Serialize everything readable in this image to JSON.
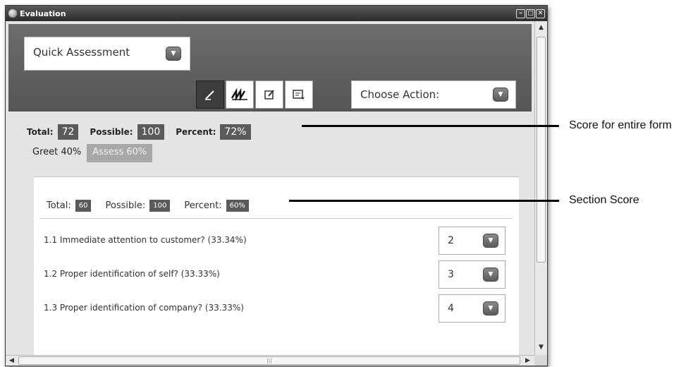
{
  "window": {
    "title": "Evaluation"
  },
  "form_select": {
    "value": "Quick Assessment"
  },
  "toolbar": {
    "tools": [
      "pen-icon",
      "signature-icon",
      "edit-note-icon",
      "preview-icon"
    ],
    "action_select": "Choose Action:"
  },
  "form_score": {
    "total_label": "Total:",
    "total": "72",
    "possible_label": "Possible:",
    "possible": "100",
    "percent_label": "Percent:",
    "percent": "72%"
  },
  "tabs": [
    {
      "label": "Greet 40%",
      "active": true
    },
    {
      "label": "Assess 60%",
      "active": false
    }
  ],
  "section_score": {
    "total_label": "Total:",
    "total": "60",
    "possible_label": "Possible:",
    "possible": "100",
    "percent_label": "Percent:",
    "percent": "60%"
  },
  "questions": [
    {
      "label": "1.1 Immediate attention to customer? (33.34%)",
      "value": "2"
    },
    {
      "label": "1.2 Proper identification of self? (33.33%)",
      "value": "3"
    },
    {
      "label": "1.3 Proper identification of company? (33.33%)",
      "value": "4"
    }
  ],
  "annotations": {
    "form_score": "Score for entire form",
    "section_score": "Section Score"
  }
}
